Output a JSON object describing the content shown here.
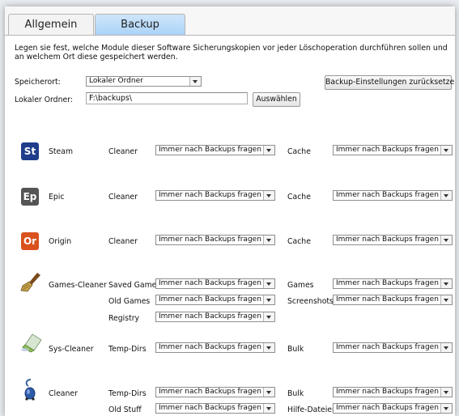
{
  "tabs": {
    "general": "Allgemein",
    "backup": "Backup"
  },
  "description": "Legen sie fest, welche Module dieser Software Sicherungskopien vor jeder Löschoperation durchführen sollen und an welchem Ort diese gespeichert werden.",
  "storage": {
    "location_label": "Speicherort:",
    "location_value": "Lokaler Ordner",
    "reset_button": "Backup-Einstellungen zurücksetzen",
    "folder_label": "Lokaler Ordner:",
    "folder_value": "F:\\backups\\",
    "choose_button": "Auswählen"
  },
  "option_text": "Immer nach Backups fragen",
  "modules": {
    "steam": {
      "icon": "steam-icon",
      "icon_text": "St",
      "icon_color": "#1f3d8a",
      "name": "Steam",
      "l1": "Cleaner",
      "r1": "Cache"
    },
    "epic": {
      "icon": "epic-icon",
      "icon_text": "Ep",
      "icon_color": "#555555",
      "name": "Epic",
      "l1": "Cleaner",
      "r1": "Cache"
    },
    "origin": {
      "icon": "origin-icon",
      "icon_text": "Or",
      "icon_color": "#d9521e",
      "name": "Origin",
      "l1": "Cleaner",
      "r1": "Cache"
    },
    "games": {
      "icon": "broom-icon",
      "name": "Games-Cleaner",
      "l1": "Saved Games",
      "r1": "Games",
      "l2": "Old Games",
      "r2": "Screenshots",
      "l3": "Registry"
    },
    "sys": {
      "icon": "eraser-icon",
      "name": "Sys-Cleaner",
      "l1": "Temp-Dirs",
      "r1": "Bulk"
    },
    "cleaner": {
      "icon": "vacuum-icon",
      "name": "Cleaner",
      "l1": "Temp-Dirs",
      "r1": "Bulk",
      "l2": "Old Stuff",
      "r2": "Hilfe-Dateien"
    }
  }
}
